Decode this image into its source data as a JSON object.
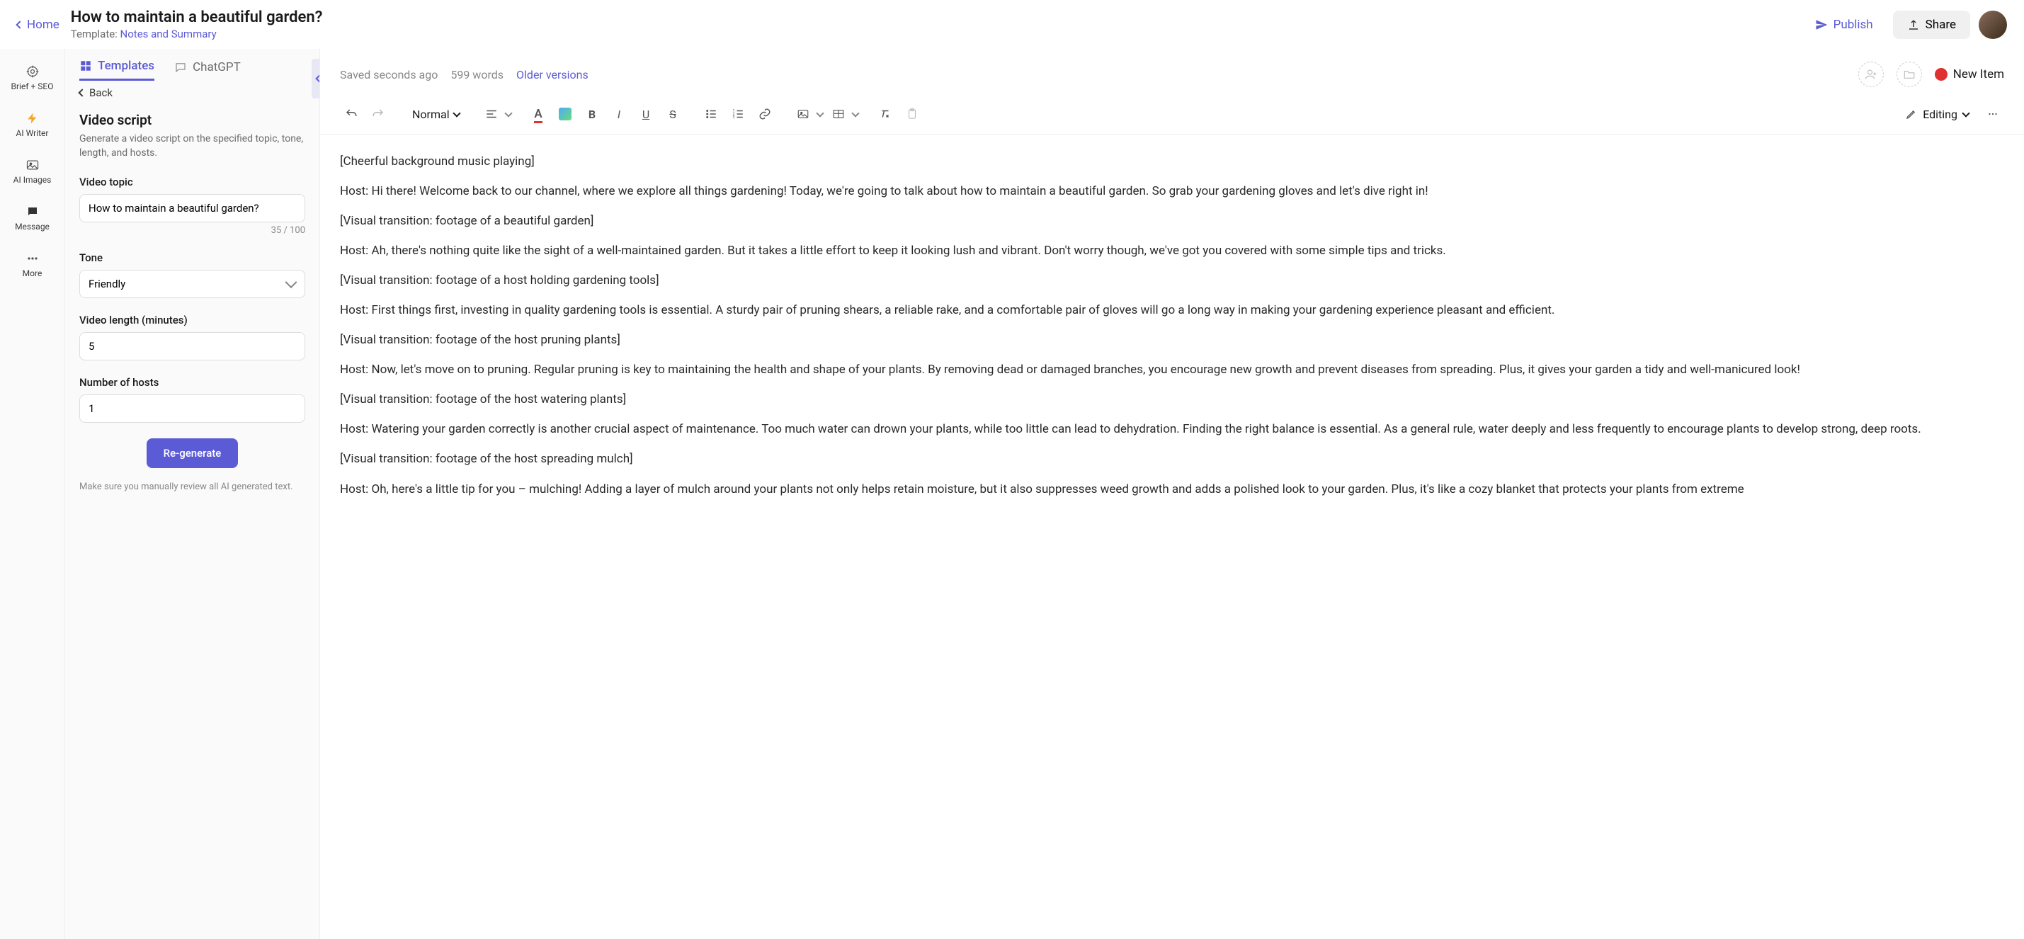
{
  "header": {
    "home": "Home",
    "title": "How to maintain a beautiful garden?",
    "template_prefix": "Template: ",
    "template_name": "Notes and Summary",
    "publish": "Publish",
    "share": "Share"
  },
  "rail": {
    "brief": "Brief + SEO",
    "writer": "AI Writer",
    "images": "AI Images",
    "message": "Message",
    "more": "More"
  },
  "sidebar": {
    "tab_templates": "Templates",
    "tab_chatgpt": "ChatGPT",
    "back": "Back",
    "panel_title": "Video script",
    "panel_desc": "Generate a video script on the specified topic, tone, length, and hosts.",
    "topic_label": "Video topic",
    "topic_value": "How to maintain a beautiful garden?",
    "char_count": "35 / 100",
    "tone_label": "Tone",
    "tone_value": "Friendly",
    "length_label": "Video length (minutes)",
    "length_value": "5",
    "hosts_label": "Number of hosts",
    "hosts_value": "1",
    "regenerate": "Re-generate",
    "footer": "Make sure you manually review all AI generated text."
  },
  "editor": {
    "saved": "Saved seconds ago",
    "words": "599 words",
    "older": "Older versions",
    "new_item": "New Item",
    "format": "Normal",
    "editing": "Editing"
  },
  "doc": {
    "p1": "[Cheerful background music playing]",
    "p2": "Host: Hi there! Welcome back to our channel, where we explore all things gardening! Today, we're going to talk about how to maintain a beautiful garden. So grab your gardening gloves and let's dive right in!",
    "p3": "[Visual transition: footage of a beautiful garden]",
    "p4": "Host: Ah, there's nothing quite like the sight of a well-maintained garden. But it takes a little effort to keep it looking lush and vibrant. Don't worry though, we've got you covered with some simple tips and tricks.",
    "p5": "[Visual transition: footage of a host holding gardening tools]",
    "p6": "Host: First things first, investing in quality gardening tools is essential. A sturdy pair of pruning shears, a reliable rake, and a comfortable pair of gloves will go a long way in making your gardening experience pleasant and efficient.",
    "p7": "[Visual transition: footage of the host pruning plants]",
    "p8": "Host: Now, let's move on to pruning. Regular pruning is key to maintaining the health and shape of your plants. By removing dead or damaged branches, you encourage new growth and prevent diseases from spreading. Plus, it gives your garden a tidy and well-manicured look!",
    "p9": "[Visual transition: footage of the host watering plants]",
    "p10": "Host: Watering your garden correctly is another crucial aspect of maintenance. Too much water can drown your plants, while too little can lead to dehydration. Finding the right balance is essential. As a general rule, water deeply and less frequently to encourage plants to develop strong, deep roots.",
    "p11": "[Visual transition: footage of the host spreading mulch]",
    "p12": "Host: Oh, here's a little tip for you – mulching! Adding a layer of mulch around your plants not only helps retain moisture, but it also suppresses weed growth and adds a polished look to your garden. Plus, it's like a cozy blanket that protects your plants from extreme"
  }
}
